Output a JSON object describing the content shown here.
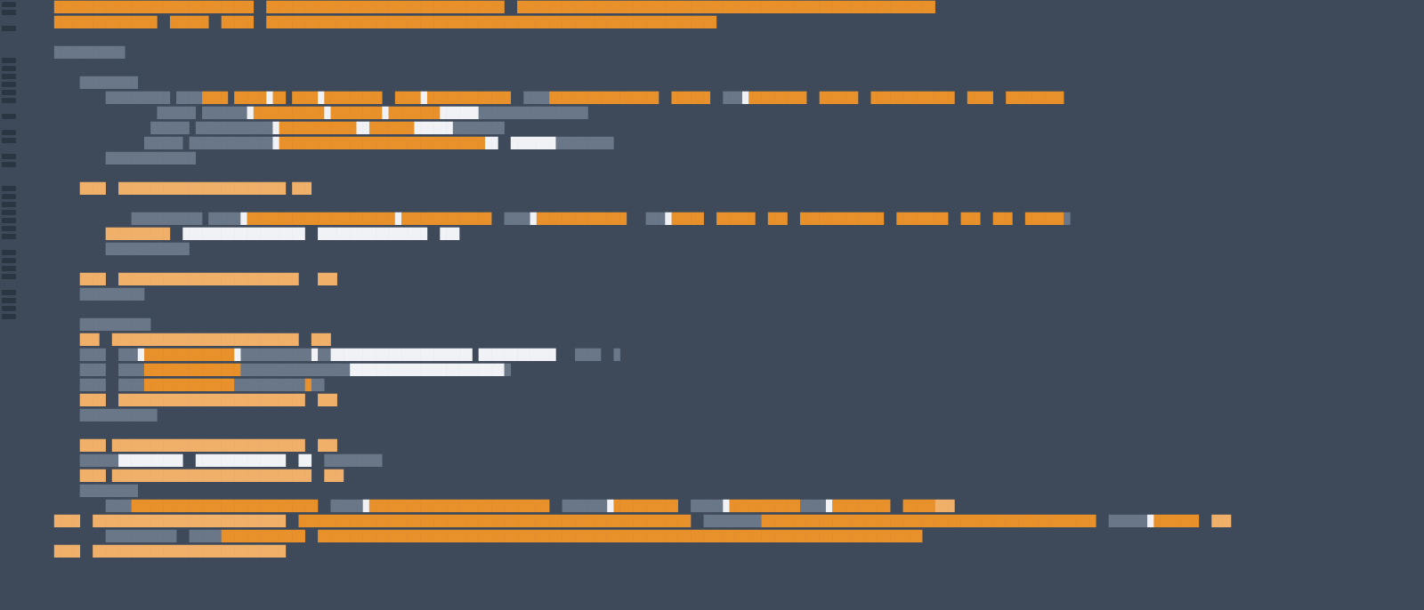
{
  "minimap": [
    "m1",
    "m1",
    "m0",
    "m1",
    "m0",
    "m0",
    "m0",
    "m2",
    "m2",
    "m2",
    "m2",
    "m2",
    "m2",
    "m0",
    "m2",
    "m0",
    "m2",
    "m2",
    "m0",
    "m2",
    "m2",
    "m0",
    "m0",
    "m2",
    "m2",
    "m2",
    "m2",
    "m2",
    "m2",
    "m2",
    "m0",
    "m2",
    "m2",
    "m2",
    "m2",
    "m0",
    "m2",
    "m2",
    "m2",
    "m2"
  ],
  "lines": [
    {
      "tokens": [
        [
          "kw",
          "    ███████████████████████████████  █████████████████████████████████████  █████████████████████████████████████████████████████████████████"
        ]
      ]
    },
    {
      "tokens": [
        [
          "kw",
          "    ████████████████  ██████  █████  ██████████████████████████████████████████████████████████████████████"
        ]
      ]
    },
    {
      "tokens": [
        [
          " ",
          ""
        ]
      ]
    },
    {
      "tokens": [
        [
          "cm",
          "    ███████████"
        ]
      ]
    },
    {
      "tokens": [
        [
          " ",
          ""
        ]
      ]
    },
    {
      "tokens": [
        [
          "cm",
          "        █████████"
        ]
      ]
    },
    {
      "tokens": [
        [
          "cm",
          "            ██████████ ████"
        ],
        [
          "kw",
          "████ █████"
        ],
        [
          "st",
          "█"
        ],
        [
          "kw",
          "██ ████"
        ],
        [
          "st",
          "█"
        ],
        [
          "kw",
          "█████████  ████"
        ],
        [
          "st",
          "█"
        ],
        [
          "kw",
          "█████████████"
        ],
        [
          "cm",
          "  ████"
        ],
        [
          "kw",
          "█████████████████  ██████"
        ],
        [
          "cm",
          "  ███"
        ],
        [
          "st",
          "█"
        ],
        [
          "kw",
          "█████████  ██████  █████████████  ████  █████████"
        ]
      ]
    },
    {
      "tokens": [
        [
          "cm",
          "                    ██████ ███████"
        ],
        [
          "st",
          "█"
        ],
        [
          "kw",
          "███████████"
        ],
        [
          "st",
          "█"
        ],
        [
          "kw",
          "████████"
        ],
        [
          "st",
          "█"
        ],
        [
          "kw",
          "████████"
        ],
        [
          "st",
          "██████"
        ],
        [
          "cm",
          "█████████████████"
        ]
      ]
    },
    {
      "tokens": [
        [
          "cm",
          "                   ██████ ████████████"
        ],
        [
          "st",
          "█"
        ],
        [
          "kw",
          "████████████"
        ],
        [
          "st",
          "██"
        ],
        [
          "kw",
          "███████"
        ],
        [
          "st",
          "██████"
        ],
        [
          "cm",
          "████████"
        ]
      ]
    },
    {
      "tokens": [
        [
          "cm",
          "                  ██████ █████████████"
        ],
        [
          "st",
          "█"
        ],
        [
          "kw",
          "████████████████████████████████"
        ],
        [
          "st",
          "██  ███████"
        ],
        [
          "cm",
          "█████████"
        ]
      ]
    },
    {
      "tokens": [
        [
          "cm",
          "            ██████████████"
        ]
      ]
    },
    {
      "tokens": [
        [
          " ",
          ""
        ]
      ]
    },
    {
      "tokens": [
        [
          "fn",
          "        ████  ██████████████████████████ ███"
        ]
      ]
    },
    {
      "tokens": [
        [
          " ",
          ""
        ]
      ]
    },
    {
      "tokens": [
        [
          "cm",
          "                ███████████ █████"
        ],
        [
          "st",
          "█"
        ],
        [
          "kw",
          "███████████████████████"
        ],
        [
          "st",
          "█"
        ],
        [
          "kw",
          "██████████████"
        ],
        [
          "cm",
          "  ████"
        ],
        [
          "st",
          "█"
        ],
        [
          "kw",
          "██████████████"
        ],
        [
          "cm",
          "   ███"
        ],
        [
          "st",
          "█"
        ],
        [
          "kw",
          "█████  ██████  ███  █████████████  ████████  ███  ███  ██████"
        ],
        [
          "cm",
          "█"
        ]
      ]
    },
    {
      "tokens": [
        [
          "fn",
          "            ██████████  "
        ],
        [
          "st",
          "███████████████████  █████████████████  ███"
        ]
      ]
    },
    {
      "tokens": [
        [
          "cm",
          "            █████████████"
        ]
      ]
    },
    {
      "tokens": [
        [
          " ",
          ""
        ]
      ]
    },
    {
      "tokens": [
        [
          "fn",
          "        ████  ████████████████████████████   ███"
        ]
      ]
    },
    {
      "tokens": [
        [
          "cm",
          "        ██████████"
        ]
      ]
    },
    {
      "tokens": [
        [
          " ",
          ""
        ]
      ]
    },
    {
      "tokens": [
        [
          "cm",
          "        ███████████"
        ]
      ]
    },
    {
      "tokens": [
        [
          "fn",
          "        ███  █████████████████████████████  ███"
        ]
      ]
    },
    {
      "tokens": [
        [
          "cm",
          "        ████  ███"
        ],
        [
          "st",
          "█"
        ],
        [
          "kw",
          "██████████████"
        ],
        [
          "st",
          "█"
        ],
        [
          "cm",
          "███████████"
        ],
        [
          "st",
          "█"
        ],
        [
          "cm",
          "██"
        ],
        [
          "st",
          "██████████████████████ ████████████"
        ],
        [
          "cm",
          "   ████  █"
        ]
      ]
    },
    {
      "tokens": [
        [
          "cm",
          "        ████  ████"
        ],
        [
          "kw",
          "███████████████"
        ],
        [
          "cm",
          "█████████████████"
        ],
        [
          "st",
          "████████████████████████"
        ],
        [
          "cm",
          "█"
        ]
      ]
    },
    {
      "tokens": [
        [
          "cm",
          "        ████  ████"
        ],
        [
          "kw",
          "██████████████"
        ],
        [
          "cm",
          "███████████"
        ],
        [
          "kw",
          "█"
        ],
        [
          "cm",
          "██"
        ]
      ]
    },
    {
      "tokens": [
        [
          "fn",
          "        ████  █████████████████████████████  ███"
        ]
      ]
    },
    {
      "tokens": [
        [
          "cm",
          "        ████████████"
        ]
      ]
    },
    {
      "tokens": [
        [
          " ",
          ""
        ]
      ]
    },
    {
      "tokens": [
        [
          "fn",
          "        ████ ██████████████████████████████  ███"
        ]
      ]
    },
    {
      "tokens": [
        [
          "cm",
          "        ██████"
        ],
        [
          "st",
          "██████████  ██████████████  ██  "
        ],
        [
          "cm",
          "█████████"
        ]
      ]
    },
    {
      "tokens": [
        [
          "fn",
          "        ████ ███████████████████████████████  ███"
        ]
      ]
    },
    {
      "tokens": [
        [
          "cm",
          "        █████████"
        ]
      ]
    },
    {
      "tokens": [
        [
          "cm",
          "            ████"
        ],
        [
          "kw",
          "█████████████████████████████"
        ],
        [
          "cm",
          "  █████"
        ],
        [
          "st",
          "█"
        ],
        [
          "kw",
          "████████████████████████████"
        ],
        [
          "cm",
          "  ███████"
        ],
        [
          "st",
          "█"
        ],
        [
          "kw",
          "██████████"
        ],
        [
          "cm",
          "  █████"
        ],
        [
          "st",
          "█"
        ],
        [
          "kw",
          "███████████"
        ],
        [
          "cm",
          "████"
        ],
        [
          "st",
          "█"
        ],
        [
          "kw",
          "█████████  █████"
        ],
        [
          "fn",
          "███"
        ]
      ]
    },
    {
      "tokens": [
        [
          "fn",
          "    ████  ██████████████████████████████  "
        ],
        [
          "kw",
          "████████"
        ],
        [
          "kw",
          "█████████████████████████████████████████████████████"
        ],
        [
          "cm",
          "  █████████"
        ],
        [
          "kw",
          "████████████████████████████████████████████████████"
        ],
        [
          "cm",
          "  ██████"
        ],
        [
          "st",
          "█"
        ],
        [
          "kw",
          "███████"
        ],
        [
          "fn",
          "  ███"
        ]
      ]
    },
    {
      "tokens": [
        [
          "cm",
          "            ███████████  █████"
        ],
        [
          "kw",
          "█████████████  ██████████████████████████████████████████████████████████████████████████████████████████████"
        ]
      ]
    },
    {
      "tokens": [
        [
          "fn",
          "    ████  ██████████████████████████████"
        ]
      ]
    }
  ]
}
